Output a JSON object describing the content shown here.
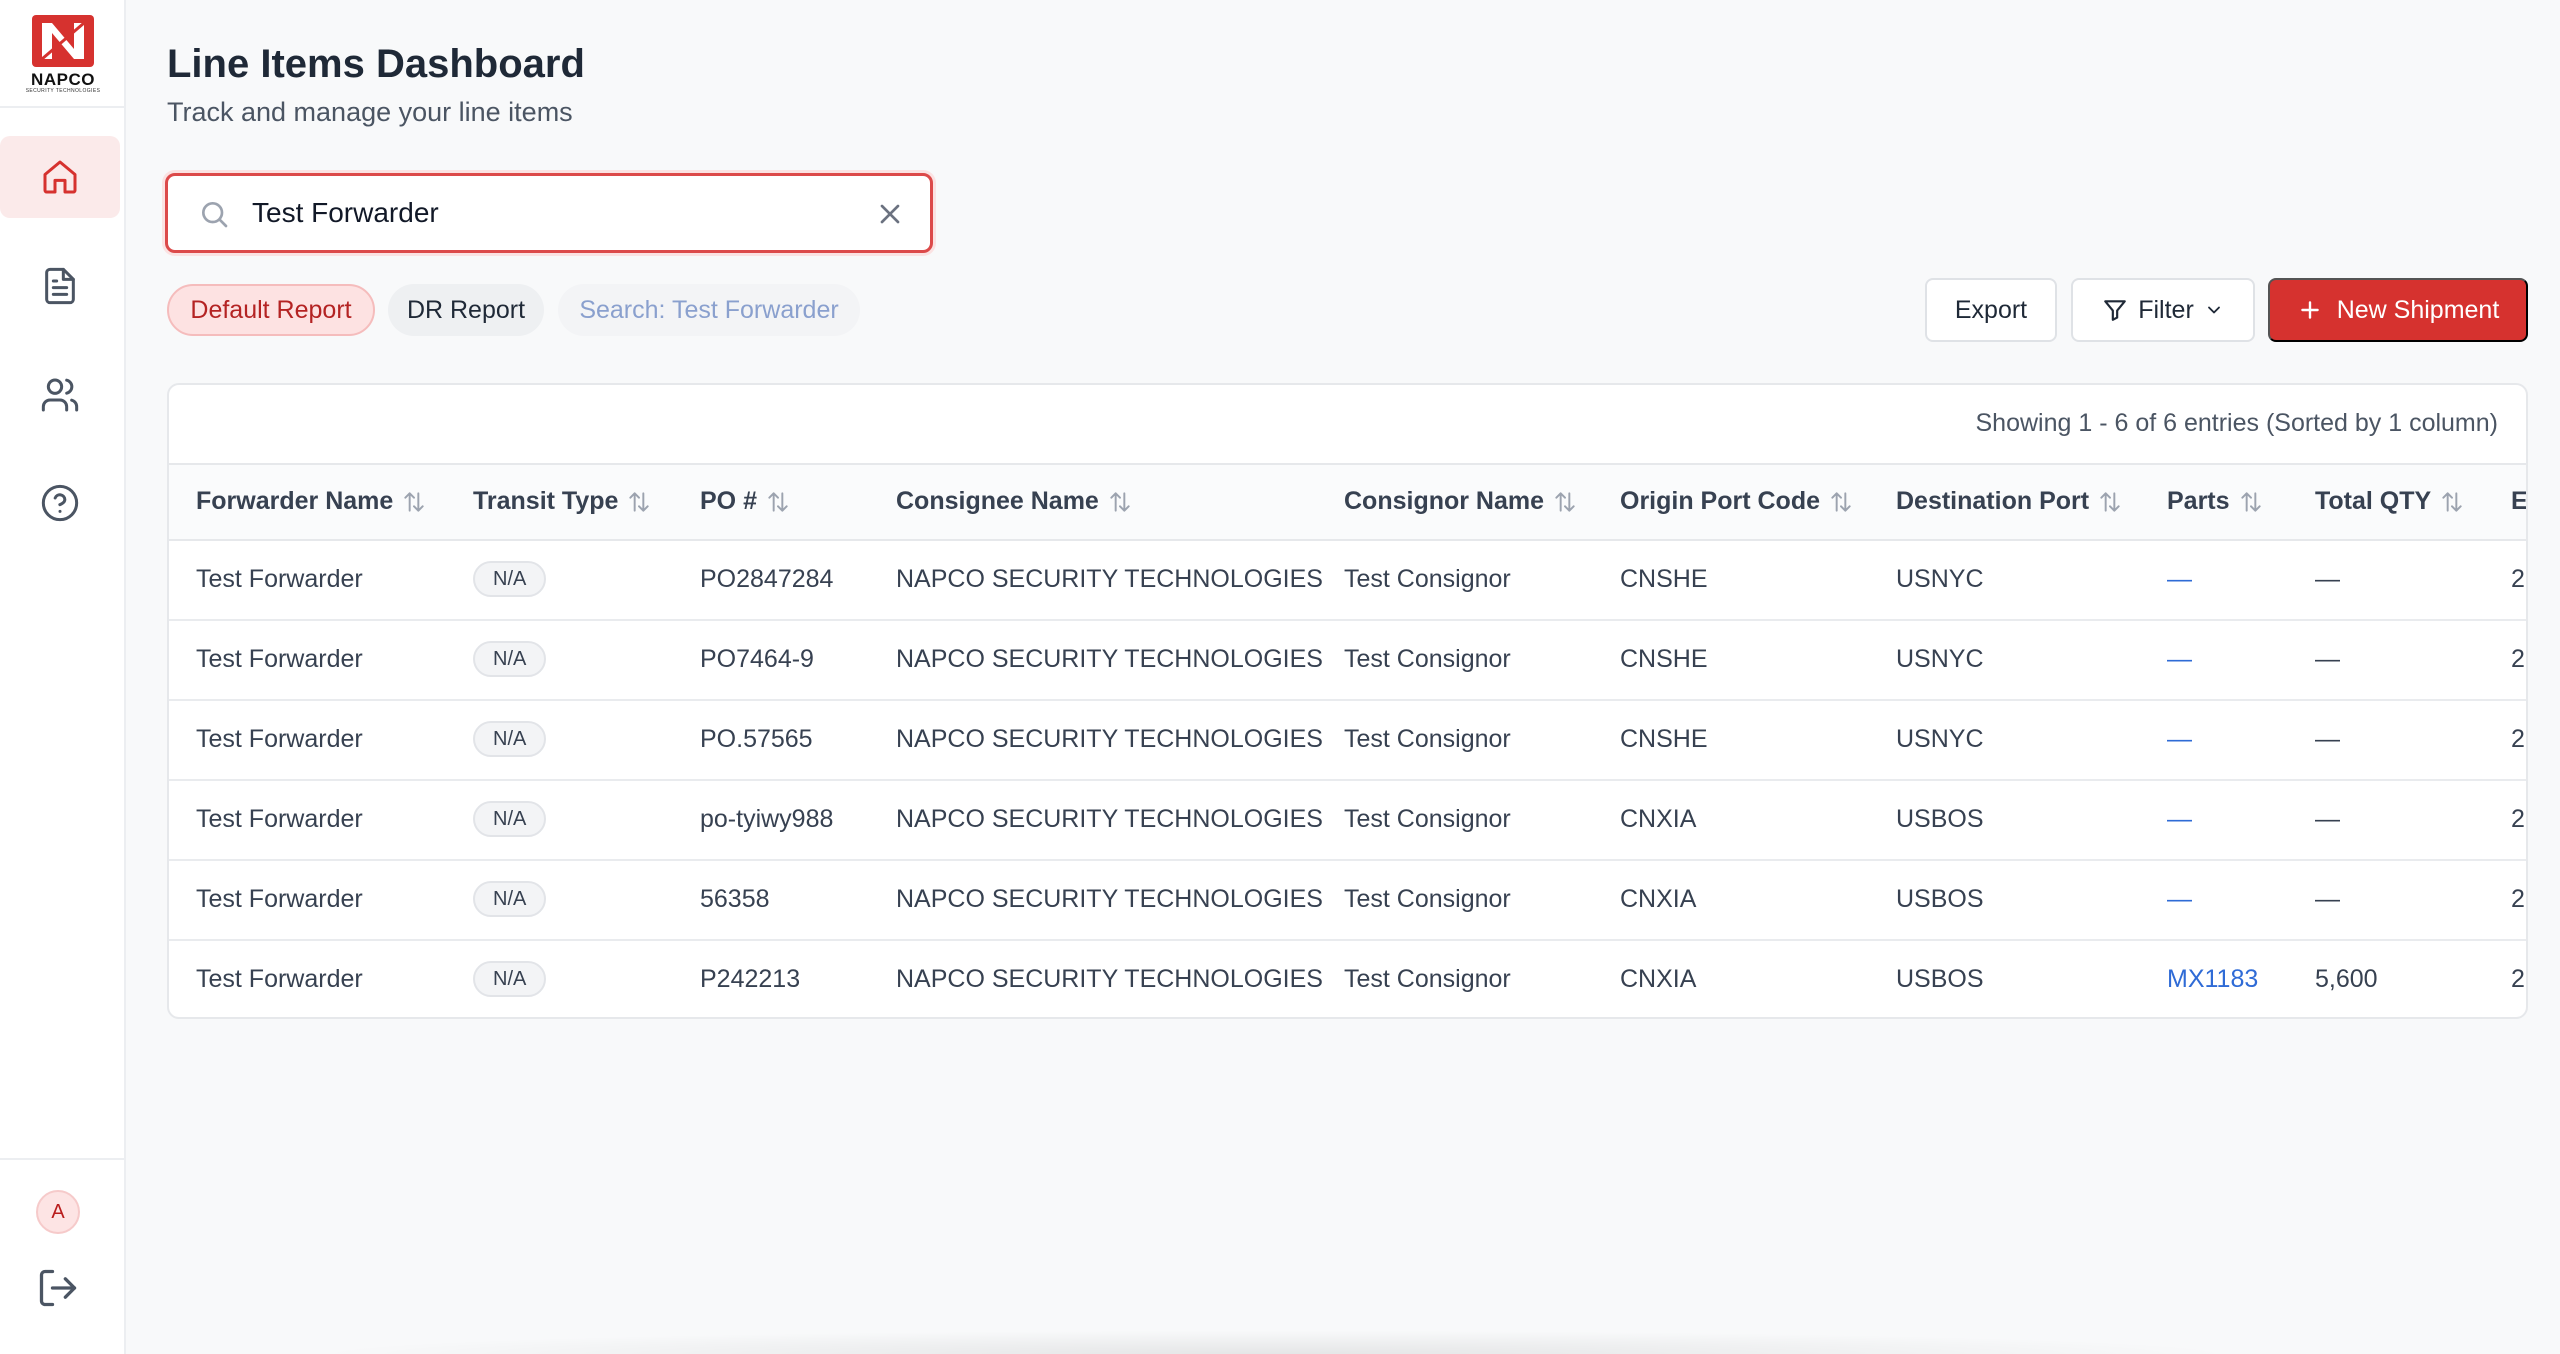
{
  "brand": {
    "name": "NAPCO",
    "tagline": "SECURITY TECHNOLOGIES",
    "accent": "#d6322f"
  },
  "sidebar": {
    "items": [
      {
        "icon": "home-icon",
        "active": true
      },
      {
        "icon": "document-icon",
        "active": false
      },
      {
        "icon": "users-icon",
        "active": false
      },
      {
        "icon": "help-icon",
        "active": false
      }
    ],
    "avatar_initial": "A",
    "logout_icon": "logout-icon"
  },
  "header": {
    "title": "Line Items Dashboard",
    "subtitle": "Track and manage your line items"
  },
  "search": {
    "value": "Test Forwarder",
    "placeholder": ""
  },
  "reports": {
    "default": "Default Report",
    "dr": "DR Report",
    "search_chip": "Search: Test Forwarder"
  },
  "toolbar": {
    "export_label": "Export",
    "filter_label": "Filter",
    "new_label": "New Shipment"
  },
  "table": {
    "info": "Showing 1 - 6 of 6 entries  (Sorted by 1 column)",
    "columns": [
      "Forwarder Name",
      "Transit Type",
      "PO #",
      "Consignee Name",
      "Consignor Name",
      "Origin Port Code",
      "Destination Port",
      "Parts",
      "Total QTY",
      "E"
    ],
    "rows": [
      [
        "Test Forwarder",
        "N/A",
        "PO2847284",
        "NAPCO SECURITY TECHNOLOGIES",
        "Test Consignor",
        "CNSHE",
        "USNYC",
        "—",
        "—",
        "2"
      ],
      [
        "Test Forwarder",
        "N/A",
        "PO7464-9",
        "NAPCO SECURITY TECHNOLOGIES",
        "Test Consignor",
        "CNSHE",
        "USNYC",
        "—",
        "—",
        "2"
      ],
      [
        "Test Forwarder",
        "N/A",
        "PO.57565",
        "NAPCO SECURITY TECHNOLOGIES",
        "Test Consignor",
        "CNSHE",
        "USNYC",
        "—",
        "—",
        "2"
      ],
      [
        "Test Forwarder",
        "N/A",
        "po-tyiwy988",
        "NAPCO SECURITY TECHNOLOGIES",
        "Test Consignor",
        "CNXIA",
        "USBOS",
        "—",
        "—",
        "2"
      ],
      [
        "Test Forwarder",
        "N/A",
        "56358",
        "NAPCO SECURITY TECHNOLOGIES",
        "Test Consignor",
        "CNXIA",
        "USBOS",
        "—",
        "—",
        "2"
      ],
      [
        "Test Forwarder",
        "N/A",
        "P242213",
        "NAPCO SECURITY TECHNOLOGIES",
        "Test Consignor",
        "CNXIA",
        "USBOS",
        "MX1183",
        "5,600",
        "2"
      ]
    ]
  }
}
